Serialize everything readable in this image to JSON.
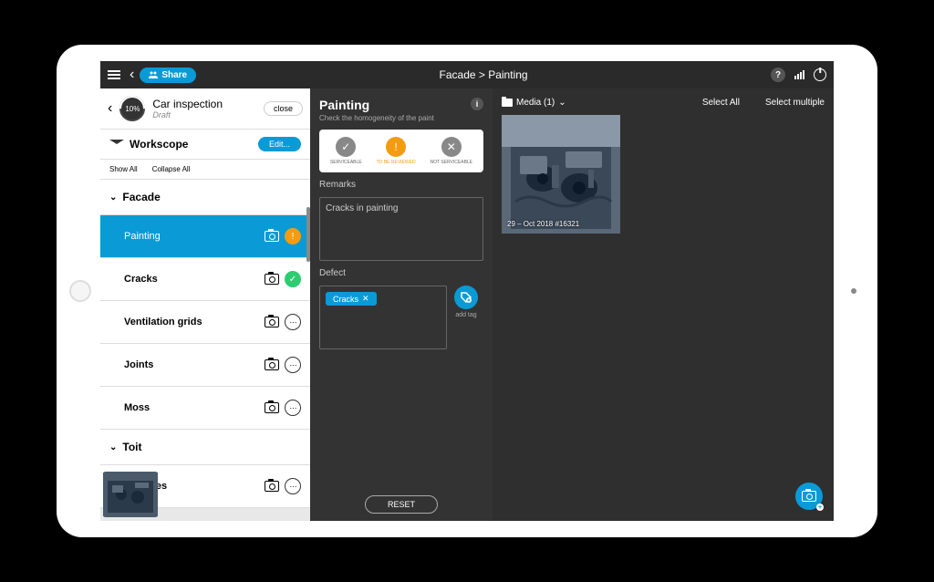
{
  "top_bar": {
    "share": "Share",
    "breadcrumb": "Facade > Painting"
  },
  "inspection": {
    "progress": "10%",
    "title": "Car inspection",
    "status": "Draft",
    "close": "close"
  },
  "workscope": {
    "title": "Workscope",
    "edit": "Edit...",
    "show_all": "Show All",
    "collapse_all": "Collapse All"
  },
  "sections": {
    "facade": "Facade",
    "toit": "Toit"
  },
  "tasks": {
    "painting": "Painting",
    "cracks": "Cracks",
    "ventilation": "Ventilation grids",
    "joints": "Joints",
    "moss": "Moss",
    "ardoises": "Ardoises"
  },
  "detail": {
    "title": "Painting",
    "subtitle": "Check the homogeneity of the paint",
    "status": {
      "serviceable": "SERVICEABLE",
      "review": "TO BE REVIEWED",
      "not_serviceable": "NOT SERVICEABLE"
    },
    "remarks_label": "Remarks",
    "remarks_value": "Cracks in painting",
    "defect_label": "Defect",
    "defect_tag": "Cracks",
    "add_tag": "add tag",
    "reset": "RESET"
  },
  "media": {
    "title": "Media (1)",
    "select_all": "Select All",
    "select_multiple": "Select multiple",
    "caption": "29 – Oct 2018 #16321"
  }
}
